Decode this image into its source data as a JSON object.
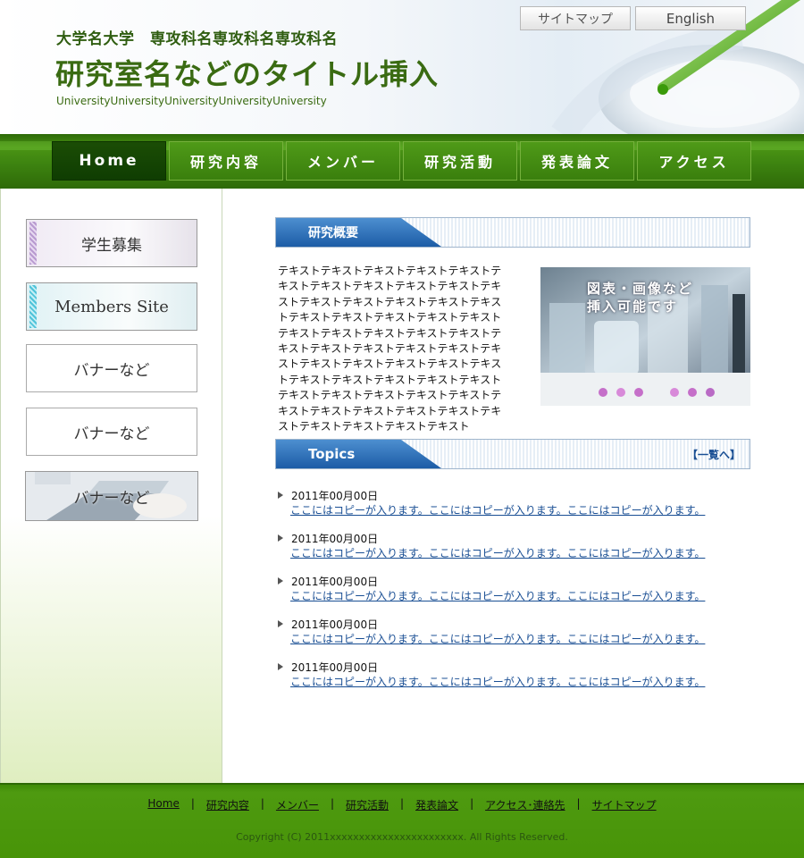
{
  "header": {
    "university_line": "大学名大学　専攻科名専攻科名専攻科名",
    "lab_title": "研究室名などのタイトル挿入",
    "university_en": "UniversityUniversityUniversityUniversityUniversity",
    "sitemap_label": "サイトマップ",
    "english_label": "English"
  },
  "nav": {
    "items": [
      {
        "label": "Home"
      },
      {
        "label": "研究内容"
      },
      {
        "label": "メンバー"
      },
      {
        "label": "研究活動"
      },
      {
        "label": "発表論文"
      },
      {
        "label": "アクセス"
      }
    ],
    "active": "Home"
  },
  "sidebar": {
    "banners": [
      {
        "label": "学生募集"
      },
      {
        "label": "Members Site"
      },
      {
        "label": "バナーなど"
      },
      {
        "label": "バナーなど"
      },
      {
        "label": "バナーなど"
      }
    ]
  },
  "overview": {
    "heading": "研究概要",
    "text": "テキストテキストテキストテキストテキストテキストテキストテキストテキストテキストテキストテキストテキストテキストテキストテキストテキストテキストテキストテキストテキストテキストテキストテキストテキストテキストテキストテキストテキストテキストテキストテキストテキストテキストテキストテキストテキストテキストテキストテキストテキストテキストテキストテキストテキストテキストテキストテキストテキストテキストテキストテキストテキストテキストテキストテキストテキスト",
    "photo_caption": "図表・画像など\n挿入可能です"
  },
  "topics": {
    "heading": "Topics",
    "list_link": "【一覧へ】",
    "items": [
      {
        "date": "2011年00月00日",
        "text": "ここにはコピーが入ります。ここにはコピーが入ります。ここにはコピーが入ります。"
      },
      {
        "date": "2011年00月00日",
        "text": "ここにはコピーが入ります。ここにはコピーが入ります。ここにはコピーが入ります。"
      },
      {
        "date": "2011年00月00日",
        "text": "ここにはコピーが入ります。ここにはコピーが入ります。ここにはコピーが入ります。"
      },
      {
        "date": "2011年00月00日",
        "text": "ここにはコピーが入ります。ここにはコピーが入ります。ここにはコピーが入ります。"
      },
      {
        "date": "2011年00月00日",
        "text": "ここにはコピーが入ります。ここにはコピーが入ります。ここにはコピーが入ります。"
      }
    ]
  },
  "footer": {
    "links": [
      {
        "label": "Home"
      },
      {
        "label": "研究内容"
      },
      {
        "label": "メンバー"
      },
      {
        "label": "研究活動"
      },
      {
        "label": "発表論文"
      },
      {
        "label": "アクセス･連絡先"
      },
      {
        "label": "サイトマップ"
      }
    ],
    "separator": "|",
    "copyright": "Copyright (C) 2011xxxxxxxxxxxxxxxxxxxxxxx. All Rights Reserved."
  },
  "colors": {
    "brand_green": "#3d8310",
    "nav_active": "#0f3d02",
    "title_green": "#3a6b12",
    "section_blue": "#1c5ca6",
    "link_blue": "#1a4f94"
  }
}
